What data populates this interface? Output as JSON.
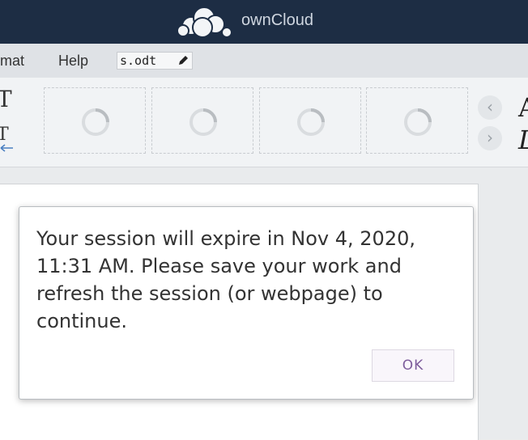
{
  "header": {
    "brand": "ownCloud",
    "logo_icon": "owncloud-cloud-icon",
    "background": "#1d2d44"
  },
  "menubar": {
    "items": [
      {
        "label": "mat"
      },
      {
        "label": "Help"
      }
    ],
    "filename": "s.odt",
    "rename_icon": "pencil-icon"
  },
  "toolbar": {
    "left_glyph_top": "T",
    "left_glyph_bottom": "T",
    "style_previews": [
      {
        "icon": "loading-spinner-icon"
      },
      {
        "icon": "loading-spinner-icon"
      },
      {
        "icon": "loading-spinner-icon"
      },
      {
        "icon": "loading-spinner-icon"
      }
    ],
    "prev_label": "‹",
    "next_label": "›",
    "right_glyph_top": "A",
    "right_glyph_bottom": "L"
  },
  "dialog": {
    "message": "Your session will expire in Nov 4, 2020, 11:31 AM. Please save your work and refresh the session (or webpage) to continue.",
    "ok_label": "OK",
    "accent": "#7d5d9c"
  }
}
